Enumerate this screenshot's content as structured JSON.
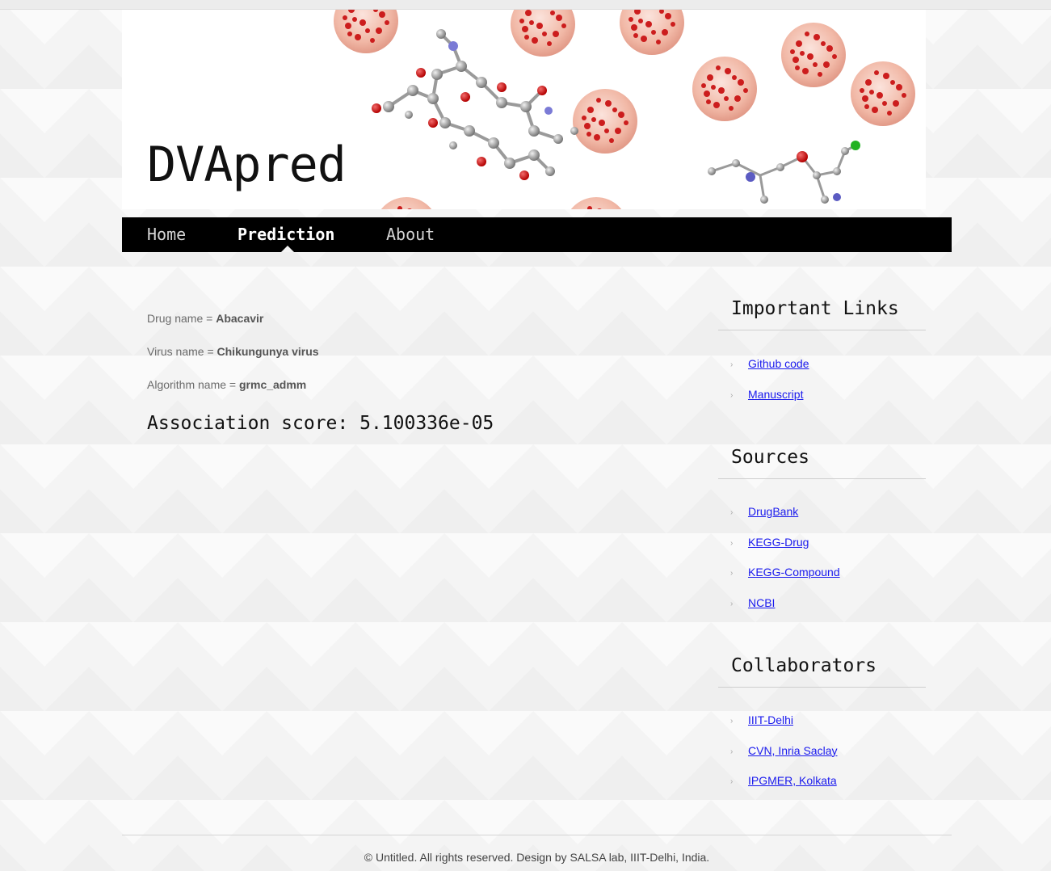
{
  "site": {
    "logo": "DVApred"
  },
  "nav": {
    "items": [
      {
        "label": "Home",
        "active": false
      },
      {
        "label": "Prediction",
        "active": true
      },
      {
        "label": "About",
        "active": false
      }
    ]
  },
  "main": {
    "params": [
      {
        "label": "Drug name = ",
        "value": "Abacavir"
      },
      {
        "label": "Virus name = ",
        "value": "Chikungunya virus"
      },
      {
        "label": "Algorithm name = ",
        "value": "grmc_admm"
      }
    ],
    "score": "Association score: 5.100336e-05"
  },
  "sidebar": {
    "sections": [
      {
        "title": "Important Links",
        "links": [
          "Github code",
          "Manuscript"
        ]
      },
      {
        "title": "Sources",
        "links": [
          "DrugBank",
          "KEGG-Drug",
          "KEGG-Compound",
          "NCBI"
        ]
      },
      {
        "title": "Collaborators",
        "links": [
          "IIIT-Delhi",
          "CVN, Inria Saclay",
          "IPGMER, Kolkata"
        ]
      }
    ]
  },
  "footer": {
    "text": "© Untitled. All rights reserved. Design by SALSA lab, IIIT-Delhi, India."
  },
  "colors": {
    "nav_bg": "#000000",
    "link": "#1a1aee",
    "virus": "#e8a08f",
    "virus_spike": "#cc1d1d"
  }
}
